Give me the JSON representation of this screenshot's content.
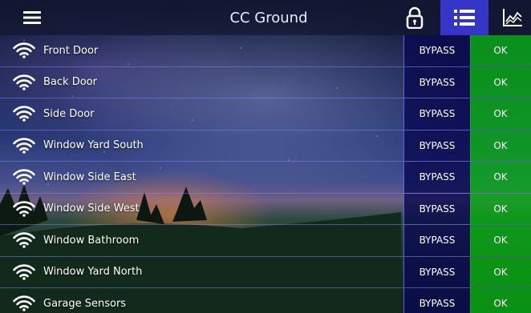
{
  "header": {
    "title": "CC Ground",
    "icons": [
      "menu-icon",
      "lock-icon",
      "list-icon",
      "chart-icon"
    ]
  },
  "zones": [
    {
      "name": "Front Door",
      "bypass_label": "BYPASS",
      "status": "OK"
    },
    {
      "name": "Back Door",
      "bypass_label": "BYPASS",
      "status": "OK"
    },
    {
      "name": "Side Door",
      "bypass_label": "BYPASS",
      "status": "OK"
    },
    {
      "name": "Window Yard South",
      "bypass_label": "BYPASS",
      "status": "OK"
    },
    {
      "name": "Window Side East",
      "bypass_label": "BYPASS",
      "status": "OK"
    },
    {
      "name": "Window Side West",
      "bypass_label": "BYPASS",
      "status": "OK"
    },
    {
      "name": "Window Bathroom",
      "bypass_label": "BYPASS",
      "status": "OK"
    },
    {
      "name": "Window Yard North",
      "bypass_label": "BYPASS",
      "status": "OK"
    },
    {
      "name": "Garage Sensors",
      "bypass_label": "BYPASS",
      "status": "OK"
    }
  ],
  "colors": {
    "active_tab": "#3535c8",
    "bypass_bg": "#0a0a50",
    "ok_bg": "#08aa14",
    "row_border": "#8c8cff"
  }
}
